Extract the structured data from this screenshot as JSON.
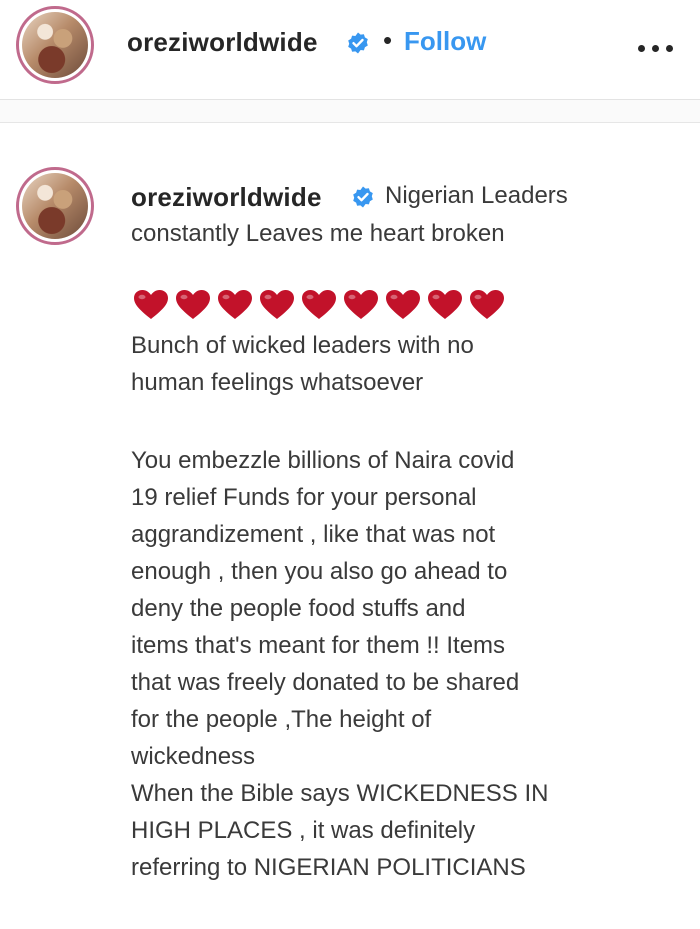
{
  "header": {
    "username": "oreziworldwide",
    "separator": "•",
    "follow_label": "Follow",
    "more_icon": "more-options-icon",
    "verified_icon": "verified-badge-icon"
  },
  "caption": {
    "username": "oreziworldwide",
    "verified_icon": "verified-badge-icon",
    "lines": [
      "Nigerian Leaders",
      "constantly Leaves me heart broken",
      "Bunch of wicked leaders with no",
      "human feelings whatsoever",
      "You embezzle billions of Naira covid",
      "19 relief Funds for your personal",
      "aggrandizement , like that was not",
      "enough , then you also go ahead to",
      "deny the people food stuffs and",
      "items that's meant for them !! Items",
      "that was freely donated to be shared",
      "for the people ,The height of",
      "wickedness",
      "When the Bible says WICKEDNESS IN",
      "HIGH PLACES , it was definitely",
      "referring to NIGERIAN POLITICIANS"
    ],
    "heart_emoji_count": 9,
    "heart_color": "#c2122a"
  },
  "colors": {
    "follow_blue": "#3897f0",
    "verified_blue": "#3897f0",
    "avatar_ring": "#c06a8c",
    "text": "#262626"
  }
}
